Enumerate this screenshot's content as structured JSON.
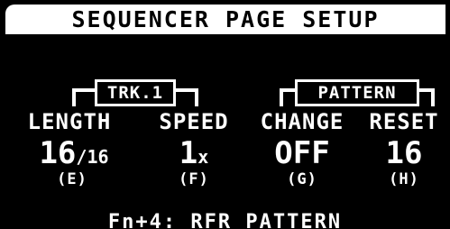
{
  "header": {
    "title": "SEQUENCER PAGE SETUP"
  },
  "groups": {
    "track": {
      "label": "TRK.1"
    },
    "pattern": {
      "label": "PATTERN"
    }
  },
  "params": {
    "length": {
      "label": "LENGTH",
      "value": "16",
      "suffix": "/16",
      "key": "(E)"
    },
    "speed": {
      "label": "SPEED",
      "value": "1",
      "suffix": "x",
      "key": "(F)"
    },
    "change": {
      "label": "CHANGE",
      "value": "OFF",
      "suffix": "",
      "key": "(G)"
    },
    "reset": {
      "label": "RESET",
      "value": "16",
      "suffix": "",
      "key": "(H)"
    }
  },
  "footer": {
    "hint": "Fn+4: RFR PATTERN"
  },
  "colors": {
    "background": "#000000",
    "foreground": "#ffffff"
  }
}
